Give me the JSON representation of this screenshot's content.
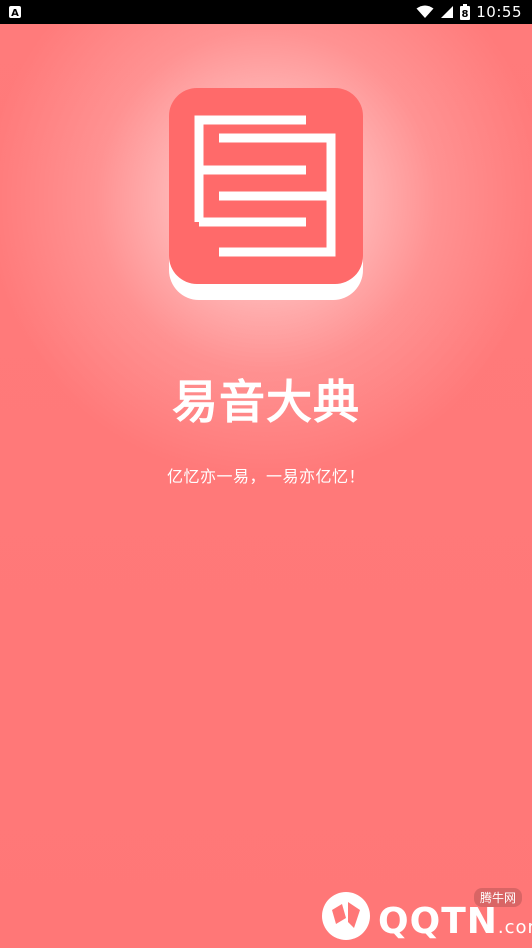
{
  "status_bar": {
    "time": "10:55",
    "battery_level": "8"
  },
  "app": {
    "title": "易音大典",
    "slogan": "亿忆亦一易，一易亦亿忆！"
  },
  "watermark": {
    "brand": "QQTN",
    "domain": ".com",
    "sub_label": "腾牛网"
  },
  "colors": {
    "background": "#ff7777",
    "logo_red": "#ff6a6a",
    "text": "#ffffff"
  },
  "icons": {
    "notification": "a-notification-icon",
    "wifi": "wifi-icon",
    "signal": "cellular-signal-icon",
    "battery": "battery-icon"
  }
}
